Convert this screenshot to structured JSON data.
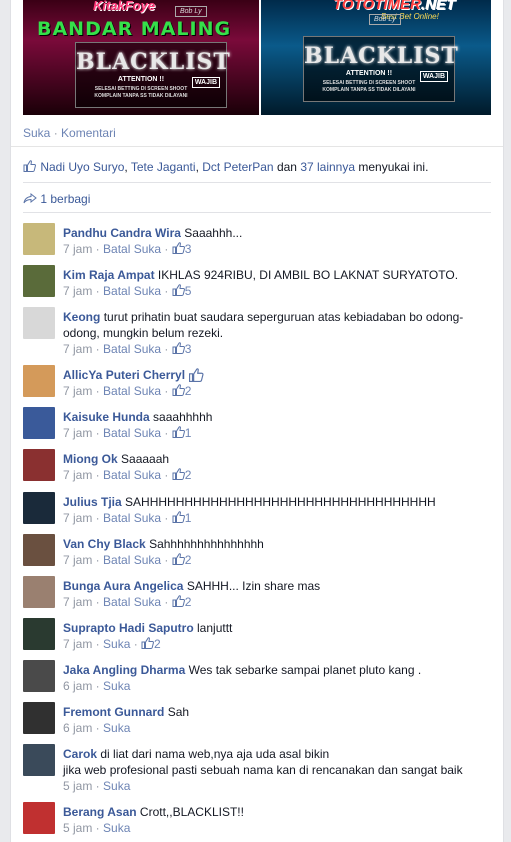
{
  "post": {
    "photo_left": {
      "top_text": "KitakFoye",
      "banner": "BANDAR MALING",
      "badge": "Bob Ly",
      "logo_text": "BLACKLIST",
      "attention": "ATTENTION !!",
      "line1": "SELESAI BETTING DI SCREEN SHOOT",
      "line2": "KOMPLAIN TANPA SS TIDAK DILAYANI",
      "wajib": "WAJIB"
    },
    "photo_right": {
      "top_text": "TOTOTIMER",
      "top_suffix": ".NET",
      "sub": "Best Bet Online!",
      "badge": "Bob Ly",
      "logo_text": "BLACKLIST",
      "attention": "ATTENTION !!",
      "line1": "SELESAI BETTING DI SCREEN SHOOT",
      "line2": "KOMPLAIN TANPA SS TIDAK DILAYANI",
      "wajib": "WAJIB"
    },
    "actions": {
      "like": "Suka",
      "separator": "·",
      "comment": "Komentari"
    },
    "likes": {
      "names": [
        "Nadi Uyo Suryo",
        "Tete Jaganti",
        "Dct PeterPan"
      ],
      "sep1": ", ",
      "sep2": ", ",
      "and": " dan ",
      "others": "37 lainnya",
      "suffix": " menyukai ini."
    },
    "shares": "1 berbagi"
  },
  "comments": [
    {
      "author": "Pandhu Candra Wira",
      "text": "Saaahhh...",
      "time": "7 jam",
      "action": "Batal Suka",
      "likes": "3",
      "color": "#c7b87a"
    },
    {
      "author": "Kim Raja Ampat",
      "text": "IKHLAS 924RIBU, DI AMBIL BO LAKNAT SURYATOTO.",
      "time": "7 jam",
      "action": "Batal Suka",
      "likes": "5",
      "color": "#5a6b3a"
    },
    {
      "author": "Keong",
      "text": "turut prihatin buat saudara seperguruan atas kebiadaban bo odong-odong, mungkin belum rezeki.",
      "time": "7 jam",
      "action": "Batal Suka",
      "likes": "3",
      "color": "#d8d8d8"
    },
    {
      "author": "AllicYa Puteri Cherryl",
      "text": "",
      "time": "7 jam",
      "action": "Batal Suka",
      "likes": "2",
      "color": "#d49a5a"
    },
    {
      "author": "Kaisuke Hunda",
      "text": "saaahhhhh",
      "time": "7 jam",
      "action": "Batal Suka",
      "likes": "1",
      "color": "#3a5a9a"
    },
    {
      "author": "Miong Ok",
      "text": "Saaaaah",
      "time": "7 jam",
      "action": "Batal Suka",
      "likes": "2",
      "color": "#8a3030"
    },
    {
      "author": "Julius Tjia",
      "text": "SAHHHHHHHHHHHHHHHHHHHHHHHHHHHHHHHHHH",
      "time": "7 jam",
      "action": "Batal Suka",
      "likes": "1",
      "color": "#1a2a3a"
    },
    {
      "author": "Van Chy Black",
      "text": "Sahhhhhhhhhhhhhhh",
      "time": "7 jam",
      "action": "Batal Suka",
      "likes": "2",
      "color": "#6a5040"
    },
    {
      "author": "Bunga Aura Angelica",
      "text": "SAHHH... Izin share mas",
      "time": "7 jam",
      "action": "Batal Suka",
      "likes": "2",
      "color": "#9a8070"
    },
    {
      "author": "Suprapto Hadi Saputro",
      "text": "lanjuttt",
      "time": "7 jam",
      "action": "Suka",
      "likes": "2",
      "color": "#2a3a30"
    },
    {
      "author": "Jaka Angling Dharma",
      "text": "Wes tak sebarke sampai planet pluto kang .",
      "time": "6 jam",
      "action": "Suka",
      "likes": "",
      "color": "#4a4a4a"
    },
    {
      "author": "Fremont Gunnard",
      "text": "Sah",
      "time": "6 jam",
      "action": "Suka",
      "likes": "",
      "color": "#303030"
    },
    {
      "author": "Carok",
      "text": "di liat dari nama web,nya aja uda asal bikin\njika web profesional pasti sebuah nama kan di rencanakan dan sangat baik",
      "time": "5 jam",
      "action": "Suka",
      "likes": "",
      "color": "#3a4a5a"
    },
    {
      "author": "Berang Asan",
      "text": "Crott,,BLACKLIST!!",
      "time": "5 jam",
      "action": "Suka",
      "likes": "",
      "color": "#c03030"
    }
  ]
}
